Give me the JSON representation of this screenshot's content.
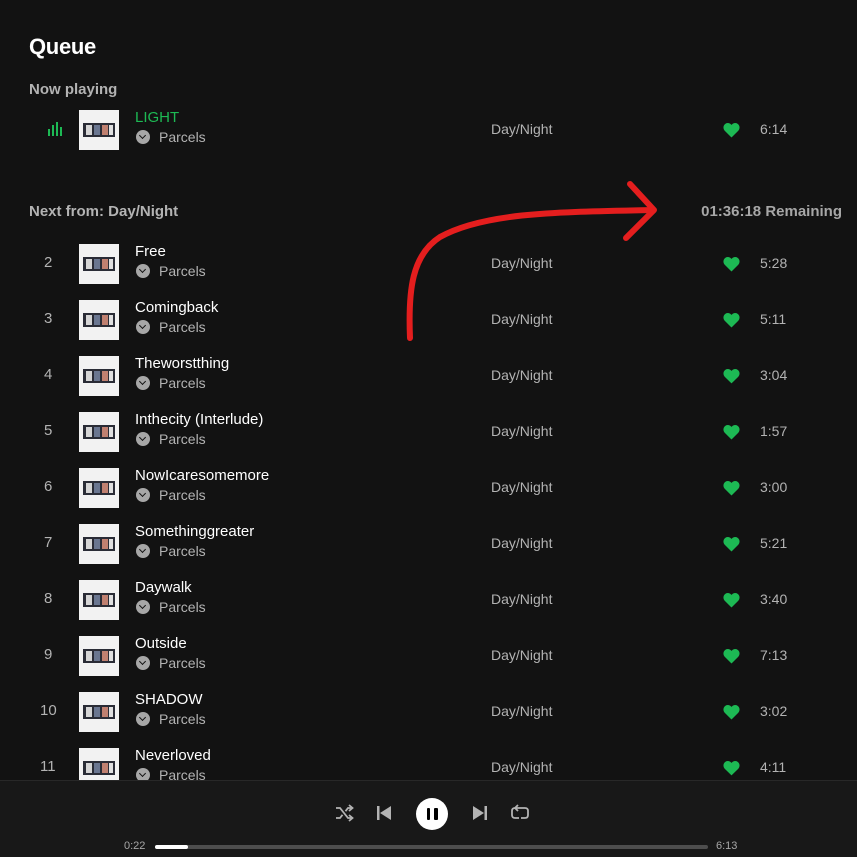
{
  "title": "Queue",
  "now_playing": {
    "label": "Now playing",
    "track": {
      "title": "LIGHT",
      "artist": "Parcels",
      "album": "Day/Night",
      "duration": "6:14"
    }
  },
  "next": {
    "label": "Next from: Day/Night",
    "remaining": "01:36:18 Remaining",
    "tracks": [
      {
        "index": "2",
        "title": "Free",
        "artist": "Parcels",
        "album": "Day/Night",
        "duration": "5:28"
      },
      {
        "index": "3",
        "title": "Comingback",
        "artist": "Parcels",
        "album": "Day/Night",
        "duration": "5:11"
      },
      {
        "index": "4",
        "title": "Theworstthing",
        "artist": "Parcels",
        "album": "Day/Night",
        "duration": "3:04"
      },
      {
        "index": "5",
        "title": "Inthecity (Interlude)",
        "artist": "Parcels",
        "album": "Day/Night",
        "duration": "1:57"
      },
      {
        "index": "6",
        "title": "NowIcaresomemore",
        "artist": "Parcels",
        "album": "Day/Night",
        "duration": "3:00"
      },
      {
        "index": "7",
        "title": "Somethinggreater",
        "artist": "Parcels",
        "album": "Day/Night",
        "duration": "5:21"
      },
      {
        "index": "8",
        "title": "Daywalk",
        "artist": "Parcels",
        "album": "Day/Night",
        "duration": "3:40"
      },
      {
        "index": "9",
        "title": "Outside",
        "artist": "Parcels",
        "album": "Day/Night",
        "duration": "7:13"
      },
      {
        "index": "10",
        "title": "SHADOW",
        "artist": "Parcels",
        "album": "Day/Night",
        "duration": "3:02"
      },
      {
        "index": "11",
        "title": "Neverloved",
        "artist": "Parcels",
        "album": "Day/Night",
        "duration": "4:11"
      }
    ]
  },
  "player": {
    "elapsed": "0:22",
    "total": "6:13",
    "progress": 0.06,
    "controls": [
      "shuffle-icon",
      "previous-icon",
      "pause-icon",
      "next-icon",
      "repeat-icon"
    ]
  },
  "colors": {
    "accent": "#1db954",
    "background": "#121212",
    "annotation": "#e41e1e"
  }
}
